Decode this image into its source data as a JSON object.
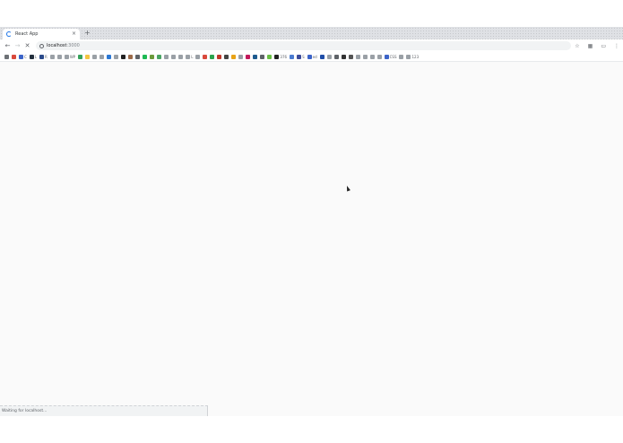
{
  "tab": {
    "title": "React App",
    "close": "×",
    "new_tab": "+"
  },
  "toolbar": {
    "back": "←",
    "forward": "→",
    "reload": "✕",
    "url_host": "localhost",
    "url_port": ":3000",
    "star": "☆",
    "ext": "▦",
    "cast": "▭",
    "menu": "⋮"
  },
  "bookmarks": [
    {
      "label": "",
      "color": "#6d7176"
    },
    {
      "label": "",
      "color": "#d9493c"
    },
    {
      "label": "C",
      "color": "#3c64c8"
    },
    {
      "label": "L",
      "color": "#222e3c"
    },
    {
      "label": "R",
      "color": "#2a4a8a"
    },
    {
      "label": "",
      "color": "#9aa0a6"
    },
    {
      "label": "",
      "color": "#9aa0a6"
    },
    {
      "label": "WP",
      "color": "#9aa0a6"
    },
    {
      "label": "",
      "color": "#37a35c"
    },
    {
      "label": "",
      "color": "#f4c542"
    },
    {
      "label": "",
      "color": "#9aa0a6"
    },
    {
      "label": "",
      "color": "#9aa0a6"
    },
    {
      "label": "",
      "color": "#2b78d4"
    },
    {
      "label": "",
      "color": "#9aa0a6"
    },
    {
      "label": "",
      "color": "#222222"
    },
    {
      "label": "",
      "color": "#9c6b4a"
    },
    {
      "label": "",
      "color": "#5f6368"
    },
    {
      "label": "",
      "color": "#1db954"
    },
    {
      "label": "",
      "color": "#6b9a3b"
    },
    {
      "label": "",
      "color": "#4aa564"
    },
    {
      "label": "",
      "color": "#9aa0a6"
    },
    {
      "label": "",
      "color": "#9aa0a6"
    },
    {
      "label": "",
      "color": "#9aa0a6"
    },
    {
      "label": "L",
      "color": "#9aa0a6"
    },
    {
      "label": "",
      "color": "#9aa0a6"
    },
    {
      "label": "",
      "color": "#d9493c"
    },
    {
      "label": "",
      "color": "#2da44e"
    },
    {
      "label": "",
      "color": "#c0392b"
    },
    {
      "label": "",
      "color": "#444444"
    },
    {
      "label": "",
      "color": "#e8a317"
    },
    {
      "label": "",
      "color": "#9aa0a6"
    },
    {
      "label": "",
      "color": "#c2185b"
    },
    {
      "label": "",
      "color": "#1e5b8f"
    },
    {
      "label": "",
      "color": "#5f6368"
    },
    {
      "label": "",
      "color": "#6ac045"
    },
    {
      "label": "376",
      "color": "#222222"
    },
    {
      "label": "",
      "color": "#4a7bd0"
    },
    {
      "label": "S",
      "color": "#3c4b9a"
    },
    {
      "label": "ed",
      "color": "#3c64c8"
    },
    {
      "label": "",
      "color": "#1f4ea8"
    },
    {
      "label": "",
      "color": "#9aa0a6"
    },
    {
      "label": "",
      "color": "#5f6368"
    },
    {
      "label": "",
      "color": "#333333"
    },
    {
      "label": "",
      "color": "#555555"
    },
    {
      "label": "",
      "color": "#9aa0a6"
    },
    {
      "label": "",
      "color": "#9aa0a6"
    },
    {
      "label": "",
      "color": "#9aa0a6"
    },
    {
      "label": "",
      "color": "#9aa0a6"
    },
    {
      "label": "CSS",
      "color": "#3c64c8"
    },
    {
      "label": "",
      "color": "#9aa0a6"
    },
    {
      "label": "123",
      "color": "#9aa0a6"
    }
  ],
  "status_text": "Waiting for localhost..."
}
